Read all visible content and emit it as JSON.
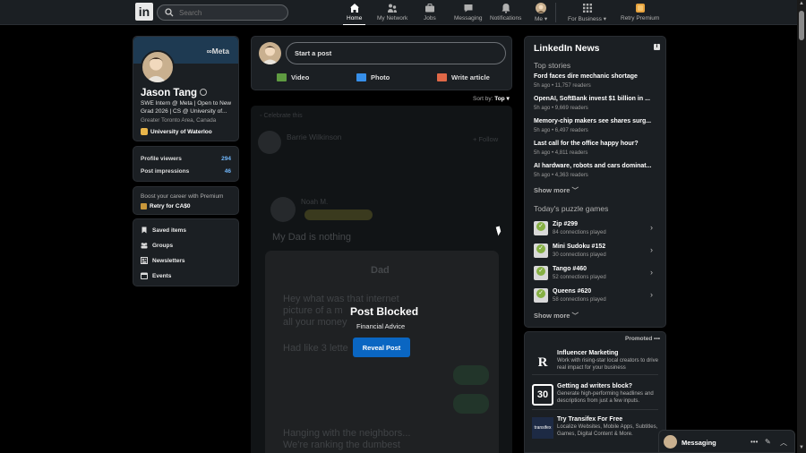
{
  "nav": {
    "search_placeholder": "Search",
    "items": [
      {
        "label": "Home",
        "icon": "home-icon"
      },
      {
        "label": "My Network",
        "icon": "network-icon"
      },
      {
        "label": "Jobs",
        "icon": "jobs-icon"
      },
      {
        "label": "Messaging",
        "icon": "messaging-icon"
      },
      {
        "label": "Notifications",
        "icon": "bell-icon"
      },
      {
        "label": "Me ▾",
        "icon": "avatar"
      },
      {
        "label": "For Business ▾",
        "icon": "grid-icon"
      },
      {
        "label": "Retry Premium",
        "icon": "premium-icon"
      }
    ],
    "logo": "in"
  },
  "profile": {
    "company_logo": "Meta",
    "name": "Jason Tang",
    "headline": "SWE Intern @ Meta | Open to New Grad 2026 | CS @ University of...",
    "location": "Greater Toronto Area, Canada",
    "school": "University of Waterloo"
  },
  "stats": [
    {
      "label": "Profile viewers",
      "value": "294"
    },
    {
      "label": "Post impressions",
      "value": "46"
    }
  ],
  "premium": {
    "text": "Boost your career with Premium",
    "cta": "Retry for CA$0"
  },
  "links": [
    "Saved items",
    "Groups",
    "Newsletters",
    "Events"
  ],
  "composer": {
    "placeholder": "Start a post",
    "actions": [
      {
        "label": "Video",
        "color": "#5f9b41"
      },
      {
        "label": "Photo",
        "color": "#378fe9"
      },
      {
        "label": "Write article",
        "color": "#e06847"
      }
    ]
  },
  "sort": {
    "label": "Sort by:",
    "value": "Top ▾"
  },
  "post": {
    "bg": {
      "header": "Celebrate this",
      "author": "Barrie Wilkinson",
      "follow": "+ Follow",
      "reposter": "Noah M.",
      "caption": "My Dad is nothing",
      "chat_title": "Dad",
      "chat_line1": "Hey what was that internet",
      "chat_line2": "picture of a m",
      "chat_line3": "all your money",
      "chat_line4": "Had like 3 lette",
      "chat_line5": "Hanging with the neighbors...",
      "chat_line6": "We're ranking the dumbest"
    },
    "blocked_title": "Post Blocked",
    "blocked_reason": "Financial Advice",
    "reveal_label": "Reveal Post"
  },
  "news": {
    "title": "LinkedIn News",
    "section": "Top stories",
    "stories": [
      {
        "headline": "Ford faces dire mechanic shortage",
        "meta": "5h ago • 11,757 readers"
      },
      {
        "headline": "OpenAI, SoftBank invest $1 billion in ...",
        "meta": "5h ago • 9,669 readers"
      },
      {
        "headline": "Memory-chip makers see shares surg...",
        "meta": "5h ago • 6,497 readers"
      },
      {
        "headline": "Last call for the office happy hour?",
        "meta": "5h ago • 4,811 readers"
      },
      {
        "headline": "AI hardware, robots and cars dominat...",
        "meta": "5h ago • 4,363 readers"
      }
    ],
    "show_more": "Show more",
    "games_title": "Today's puzzle games",
    "games": [
      {
        "name": "Zip #299",
        "meta": "84 connections played"
      },
      {
        "name": "Mini Sudoku #152",
        "meta": "30 connections played"
      },
      {
        "name": "Tango #460",
        "meta": "52 connections played"
      },
      {
        "name": "Queens #620",
        "meta": "58 connections played"
      }
    ],
    "games_more": "Show more"
  },
  "promoted": {
    "label": "Promoted",
    "ads": [
      {
        "logo": "R",
        "name": "Influencer Marketing",
        "desc": "Work with rising-star local creators to drive real impact for your business"
      },
      {
        "logo": "30",
        "name": "Getting ad writers block?",
        "desc": "Generate high-performing headlines and descriptions from just a few inputs."
      },
      {
        "logo": "transifex",
        "name": "Try Transifex For Free",
        "desc": "Localize Websites, Mobile Apps, Subtitles, Games, Digital Content & More."
      }
    ]
  },
  "messaging": {
    "label": "Messaging"
  }
}
